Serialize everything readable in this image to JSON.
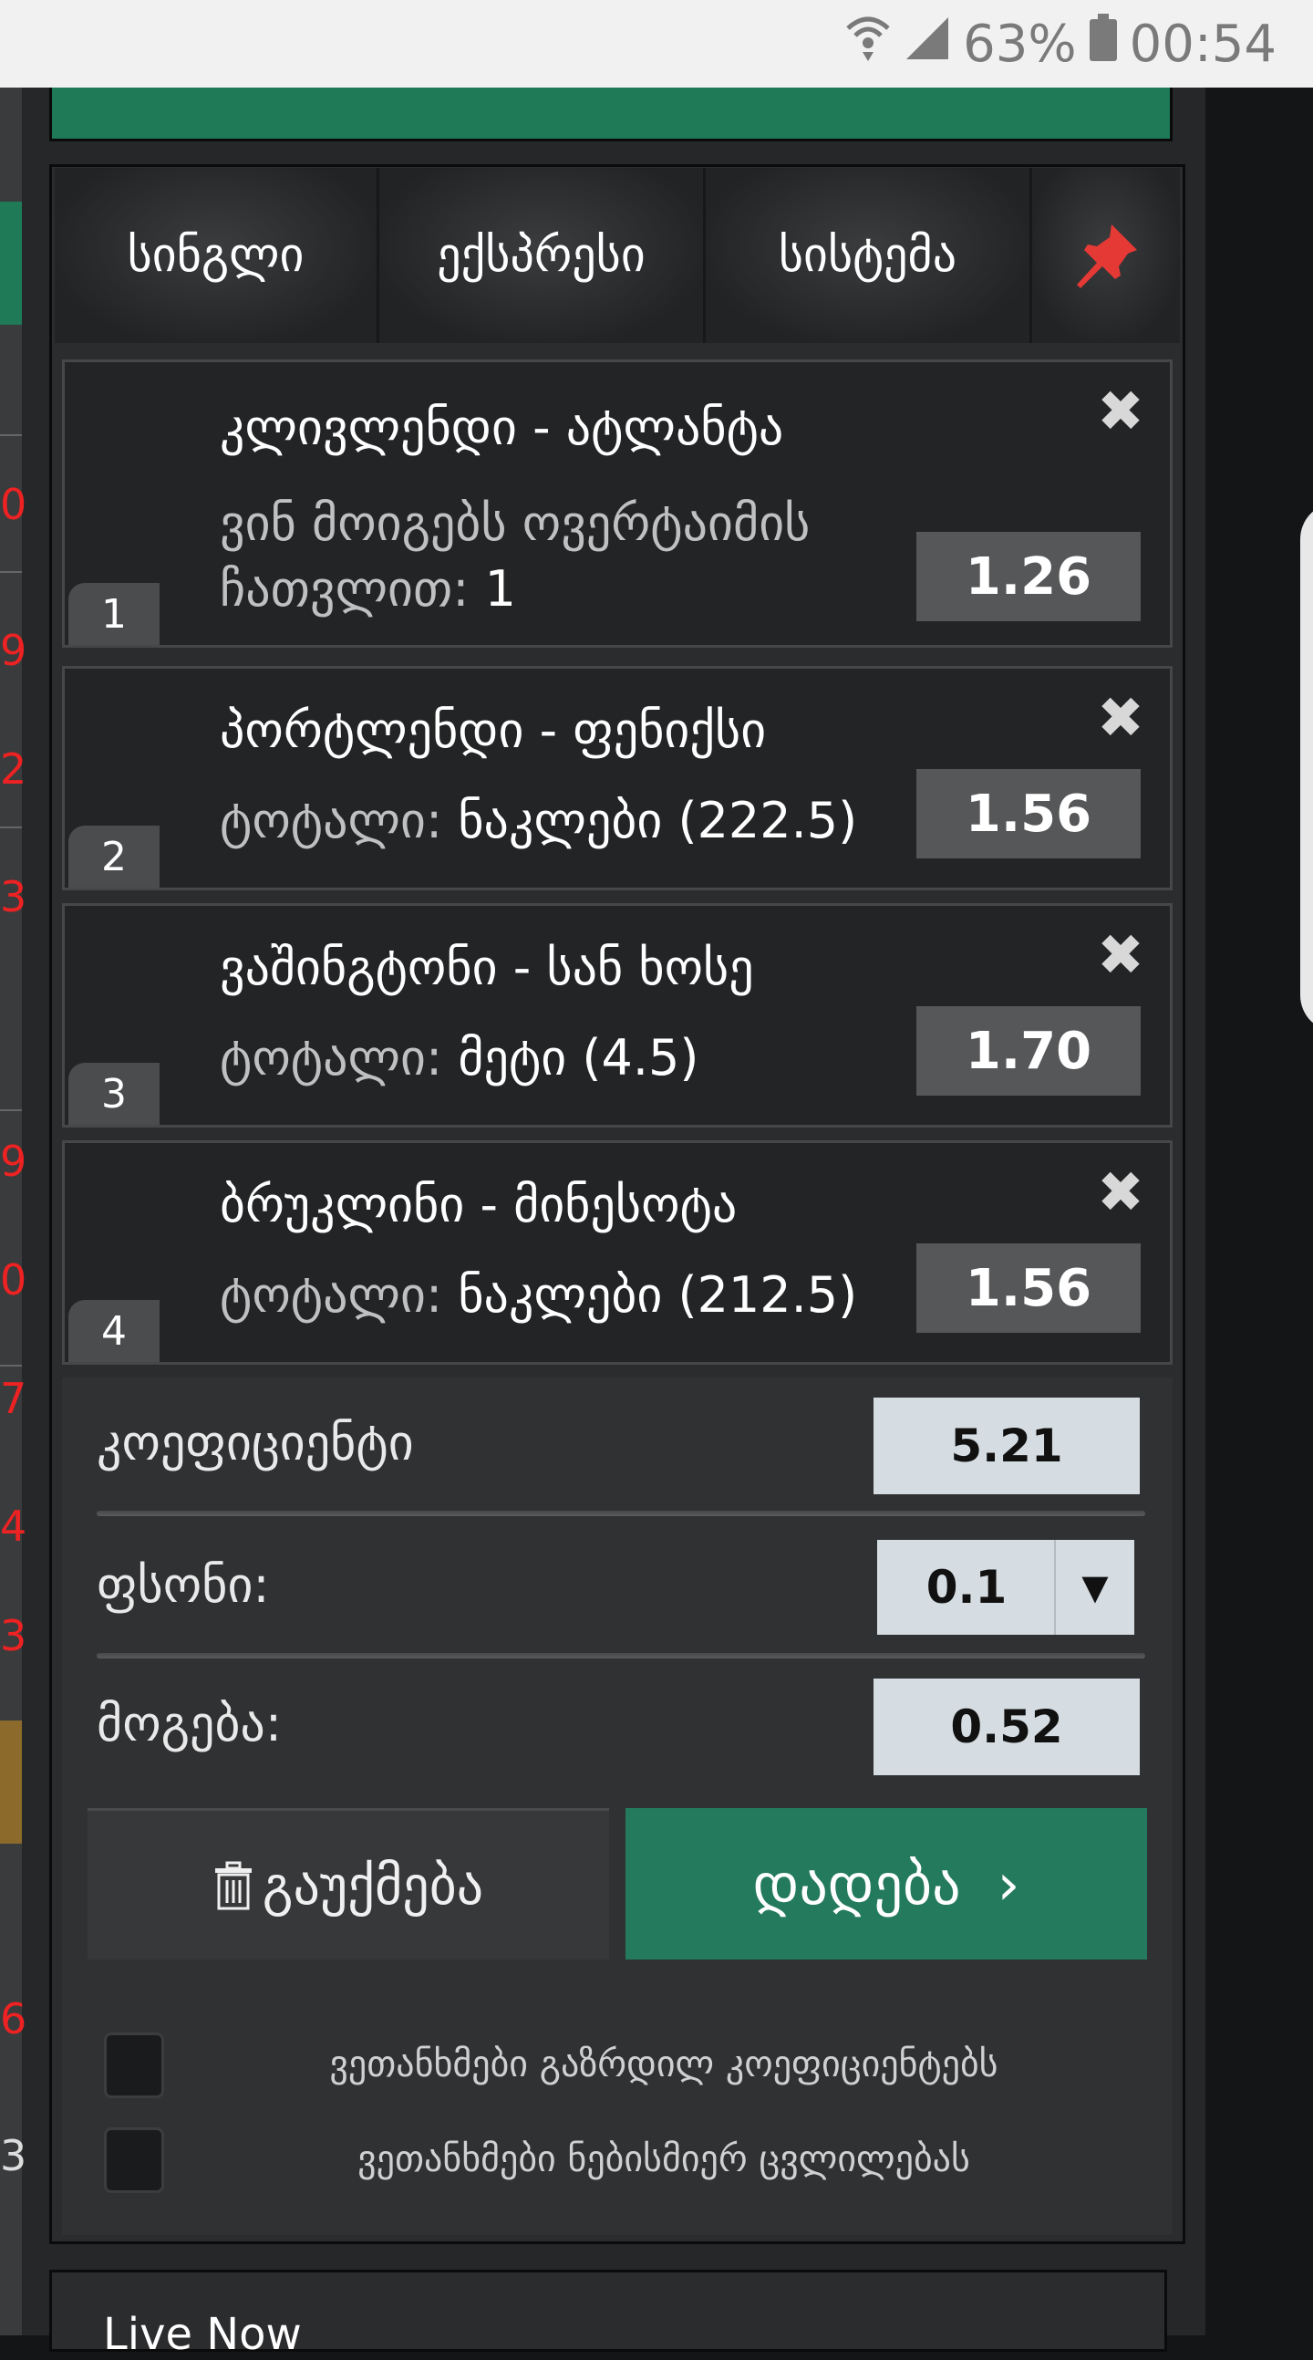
{
  "status_bar": {
    "battery": "63%",
    "time": "00:54"
  },
  "tabs": [
    {
      "label": "სინგლი"
    },
    {
      "label": "ექსპრესი"
    },
    {
      "label": "სისტემა"
    }
  ],
  "bets": [
    {
      "number": "1",
      "match": "კლივლენდი - ატლანტა",
      "market_line1": "ვინ მოიგებს ოვერტაიმის",
      "market_line2": "ჩათვლით:",
      "selection": "1",
      "odds": "1.26"
    },
    {
      "number": "2",
      "match": "პორტლენდი - ფენიქსი",
      "market": "ტოტალი:",
      "selection": "ნაკლები (222.5)",
      "odds": "1.56"
    },
    {
      "number": "3",
      "match": "ვაშინგტონი - სან ხოსე",
      "market": "ტოტალი:",
      "selection": "მეტი (4.5)",
      "odds": "1.70"
    },
    {
      "number": "4",
      "match": "ბრუკლინი - მინესოტა",
      "market": "ტოტალი:",
      "selection": "ნაკლები (212.5)",
      "odds": "1.56"
    }
  ],
  "summary": {
    "coefficient_label": "კოეფიციენტი",
    "coefficient_value": "5.21",
    "stake_label": "ფსონი:",
    "stake_value": "0.1",
    "win_label": "მოგება:",
    "win_value": "0.52"
  },
  "buttons": {
    "cancel": "გაუქმება",
    "place": "დადება"
  },
  "checkboxes": [
    {
      "label": "ვეთანხმები გაზრდილ კოეფიციენტებს"
    },
    {
      "label": "ვეთანხმები ნებისმიერ ცვლილებას"
    }
  ],
  "left_strip_numbers": [
    "0",
    "9",
    "2",
    "3",
    "9",
    "0",
    "7",
    "4",
    "3",
    "6",
    "3"
  ],
  "live_section": {
    "title": "Live Now"
  },
  "colors": {
    "accent_green": "#237a5c",
    "pin_red": "#e53935",
    "odds_box": "#565759"
  }
}
